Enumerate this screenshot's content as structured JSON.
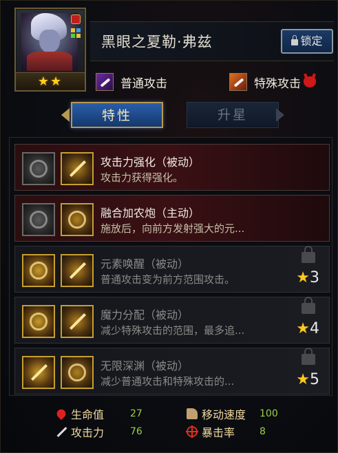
{
  "character": {
    "name": "黑眼之夏勒·弗兹",
    "stars": "★★",
    "lock_label": "锁定"
  },
  "attacks": {
    "normal_label": "普通攻击",
    "special_label": "特殊攻击"
  },
  "tabs": {
    "traits_label": "特性",
    "upgrade_label": "升星"
  },
  "skills": [
    {
      "title": "攻击力强化（被动）",
      "desc": "攻击力获得强化。",
      "locked": false
    },
    {
      "title": "融合加农炮（主动）",
      "desc": "施放后，向前方发射强大的元...",
      "locked": false
    },
    {
      "title": "元素唤醒（被动）",
      "desc": "普通攻击变为前方范围攻击。",
      "locked": true,
      "star_req": "3"
    },
    {
      "title": "魔力分配（被动）",
      "desc": "减少特殊攻击的范围，最多追...",
      "locked": true,
      "star_req": "4"
    },
    {
      "title": "无限深渊（被动）",
      "desc": "减少普通攻击和特殊攻击的...",
      "locked": true,
      "star_req": "5"
    }
  ],
  "stats": {
    "hp_label": "生命值",
    "hp_value": "27",
    "atk_label": "攻击力",
    "atk_value": "76",
    "speed_label": "移动速度",
    "speed_value": "100",
    "crit_label": "暴击率",
    "crit_value": "8"
  },
  "icons": {
    "star": "★",
    "colors": {
      "gold": "#ffc820",
      "blue_tab": "#2a5ea8",
      "red_row": "#3a1014"
    }
  }
}
